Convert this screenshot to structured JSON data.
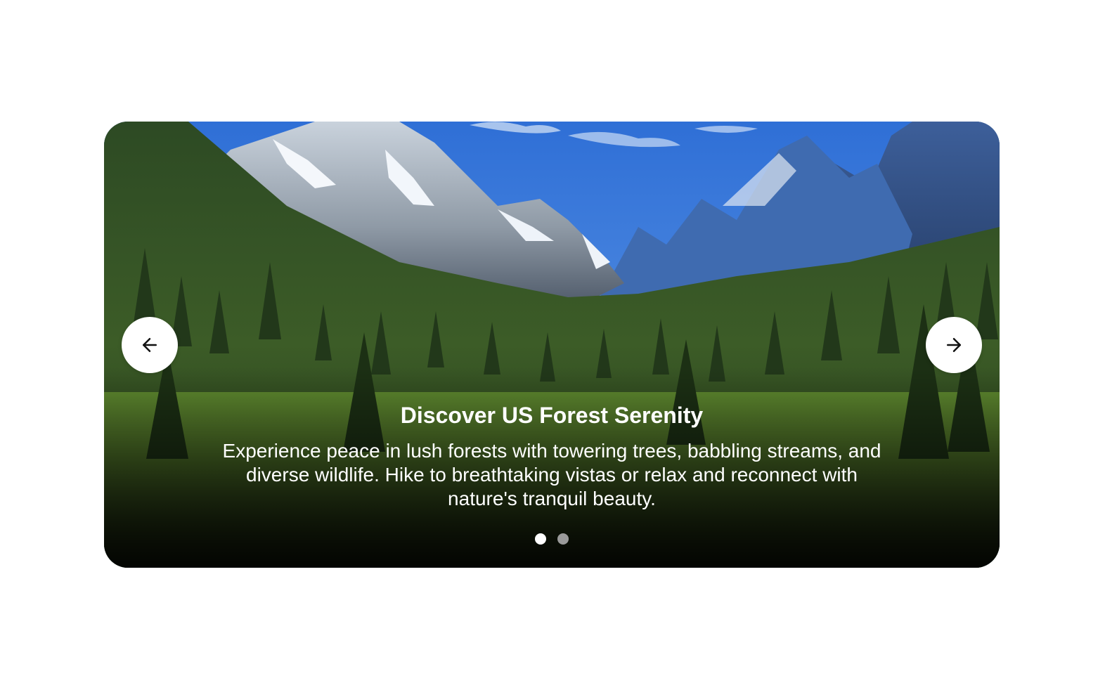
{
  "carousel": {
    "slide": {
      "title": "Discover US Forest Serenity",
      "description": "Experience peace in lush forests with towering trees, babbling streams, and diverse wildlife. Hike to breathtaking vistas or relax and reconnect with nature's tranquil beauty."
    },
    "prev_icon": "arrow-left-icon",
    "next_icon": "arrow-right-icon",
    "pagination": {
      "total": 2,
      "active_index": 0
    },
    "colors": {
      "button_bg": "#ffffff",
      "icon": "#111111",
      "dot_active": "#ffffff",
      "dot_inactive": "#9a9a9a",
      "caption_text": "#ffffff"
    }
  }
}
